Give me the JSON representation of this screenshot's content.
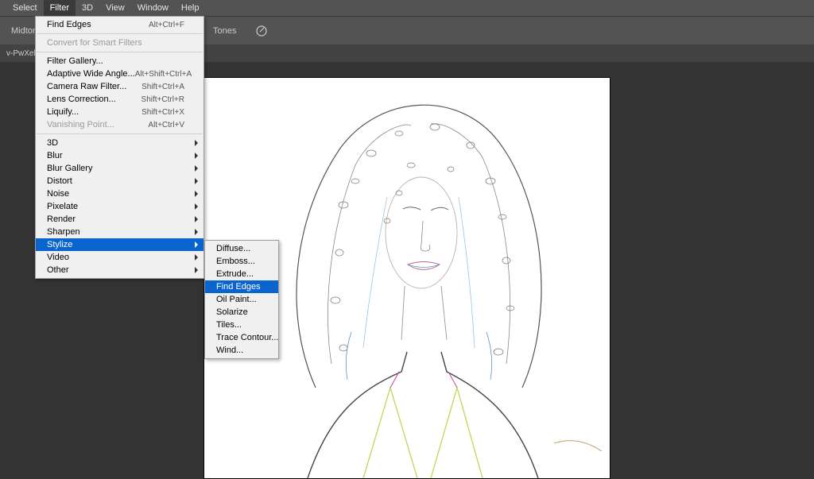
{
  "menubar": {
    "items": [
      "Select",
      "Filter",
      "3D",
      "View",
      "Window",
      "Help"
    ],
    "active_index": 1
  },
  "toolbar": {
    "label_midtones_fragment": "Midtor",
    "label_tones": "Tones"
  },
  "tab": {
    "label_fragment": "v-PwXek_"
  },
  "filter_menu": {
    "recent": {
      "label": "Find Edges",
      "shortcut": "Alt+Ctrl+F"
    },
    "convert_smart": "Convert for Smart Filters",
    "items_group1": [
      {
        "label": "Filter Gallery...",
        "shortcut": ""
      },
      {
        "label": "Adaptive Wide Angle...",
        "shortcut": "Alt+Shift+Ctrl+A"
      },
      {
        "label": "Camera Raw Filter...",
        "shortcut": "Shift+Ctrl+A"
      },
      {
        "label": "Lens Correction...",
        "shortcut": "Shift+Ctrl+R"
      },
      {
        "label": "Liquify...",
        "shortcut": "Shift+Ctrl+X"
      },
      {
        "label": "Vanishing Point...",
        "shortcut": "Alt+Ctrl+V",
        "disabled": true
      }
    ],
    "items_group2": [
      {
        "label": "3D",
        "sub": true
      },
      {
        "label": "Blur",
        "sub": true
      },
      {
        "label": "Blur Gallery",
        "sub": true
      },
      {
        "label": "Distort",
        "sub": true
      },
      {
        "label": "Noise",
        "sub": true
      },
      {
        "label": "Pixelate",
        "sub": true
      },
      {
        "label": "Render",
        "sub": true
      },
      {
        "label": "Sharpen",
        "sub": true
      },
      {
        "label": "Stylize",
        "sub": true,
        "highlighted": true
      },
      {
        "label": "Video",
        "sub": true
      },
      {
        "label": "Other",
        "sub": true
      }
    ]
  },
  "stylize_submenu": {
    "items": [
      {
        "label": "Diffuse..."
      },
      {
        "label": "Emboss..."
      },
      {
        "label": "Extrude..."
      },
      {
        "label": "Find Edges",
        "highlighted": true
      },
      {
        "label": "Oil Paint..."
      },
      {
        "label": "Solarize"
      },
      {
        "label": "Tiles..."
      },
      {
        "label": "Trace Contour..."
      },
      {
        "label": "Wind..."
      }
    ]
  }
}
